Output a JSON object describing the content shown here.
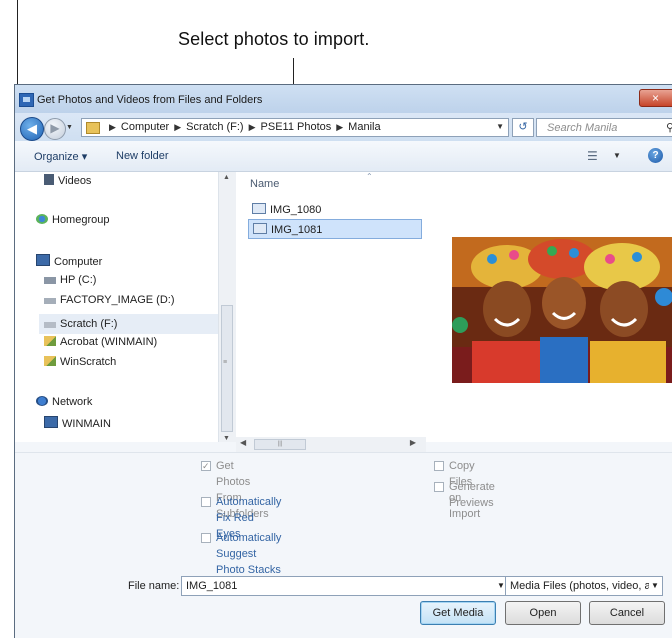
{
  "callout": {
    "text": "Select photos to import."
  },
  "window": {
    "title": "Get Photos and Videos from Files and Folders",
    "close_label": "×"
  },
  "address": {
    "crumbs": [
      "Computer",
      "Scratch (F:)",
      "PSE11 Photos",
      "Manila"
    ],
    "search_placeholder": "Search Manila"
  },
  "toolbar": {
    "organize_label": "Organize ▾",
    "new_folder_label": "New folder",
    "help_label": "?"
  },
  "nav": {
    "items": [
      {
        "label": "Videos",
        "icon": "videos-library-icon"
      },
      {
        "label": "Homegroup",
        "icon": "homegroup-icon"
      },
      {
        "label": "Computer",
        "icon": "computer-icon"
      },
      {
        "label": "HP (C:)",
        "icon": "drive-icon"
      },
      {
        "label": "FACTORY_IMAGE (D:)",
        "icon": "drive-icon"
      },
      {
        "label": "Scratch (F:)",
        "icon": "drive-icon",
        "selected": true
      },
      {
        "label": "Acrobat (WINMAIN)",
        "icon": "network-drive-icon"
      },
      {
        "label": "WinScratch",
        "icon": "network-drive-icon"
      },
      {
        "label": "Network",
        "icon": "network-icon"
      },
      {
        "label": "WINMAIN",
        "icon": "network-computer-icon"
      }
    ]
  },
  "files": {
    "column_header": "Name",
    "items": [
      {
        "name": "IMG_1080",
        "selected": false
      },
      {
        "name": "IMG_1081",
        "selected": true
      }
    ]
  },
  "preview": {
    "alt": "Selected photo preview"
  },
  "options": {
    "get_from_subfolders": {
      "label_line1": "Get Photos From",
      "label_line2": "Subfolders",
      "checked": true,
      "enabled": false
    },
    "fix_red_eyes": {
      "label_line1": "Automatically Fix Red",
      "label_line2": "Eyes",
      "checked": false
    },
    "suggest_stacks": {
      "label_line1": "Automatically Suggest",
      "label_line2": "Photo Stacks",
      "checked": false
    },
    "copy_files": {
      "label": "Copy Files on Import",
      "checked": false,
      "enabled": false
    },
    "generate_previews": {
      "label": "Generate Previews",
      "checked": false,
      "enabled": false
    }
  },
  "filename": {
    "label": "File name:",
    "value": "IMG_1081"
  },
  "filetype": {
    "value": "Media Files (photos, video, a"
  },
  "buttons": {
    "get_media": "Get Media",
    "open": "Open",
    "cancel": "Cancel"
  }
}
